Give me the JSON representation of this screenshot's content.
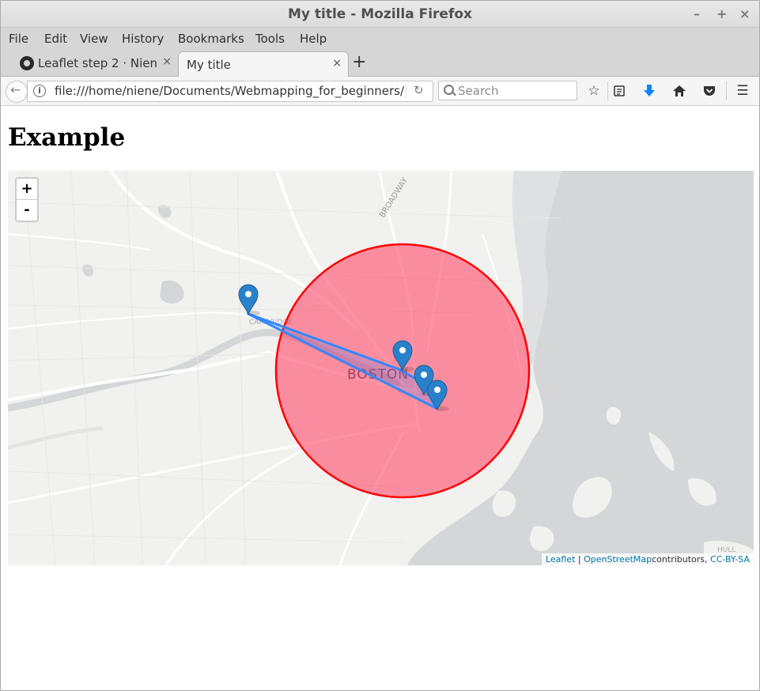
{
  "window": {
    "title": "My title - Mozilla Firefox",
    "minimize": "–",
    "maximize": "+",
    "close": "×"
  },
  "menu": [
    "File",
    "Edit",
    "View",
    "History",
    "Bookmarks",
    "Tools",
    "Help"
  ],
  "tabs": [
    {
      "label": "Leaflet step 2 · Nien…",
      "close": "×",
      "icon": "github-icon"
    },
    {
      "label": "My title",
      "close": "×"
    }
  ],
  "new_tab": "+",
  "nav": {
    "url": "file:///home/niene/Documents/Webmapping_for_beginners/",
    "search_placeholder": "Search"
  },
  "page": {
    "heading": "Example"
  },
  "map": {
    "zoom_in": "+",
    "zoom_out": "-",
    "labels": {
      "city": "BOSTON",
      "cambridge": "CAMBRIDGE",
      "road": "BROADWAY",
      "hull": "HULL"
    },
    "attribution": {
      "leaflet": "Leaflet",
      "sep": " | ",
      "osm": "OpenStreetMap",
      "contrib": "contributors, ",
      "license": "CC-BY-SA"
    },
    "circle": {
      "fill": "#ff3b5c",
      "stroke": "#ff0000"
    },
    "polyline_color": "#3388ff",
    "marker_color": "#2a81cb"
  }
}
